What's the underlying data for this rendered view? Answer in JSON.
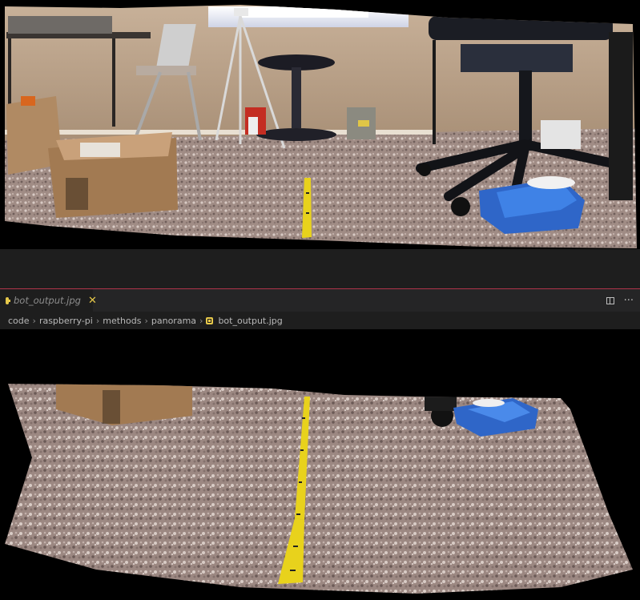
{
  "editor": {
    "tab": {
      "label": "bot_output.jpg",
      "icon": "image-file-icon",
      "close_glyph": "✕"
    },
    "actions": {
      "split_icon": "split-editor-icon",
      "more_glyph": "···"
    },
    "breadcrumb": [
      "code",
      "raspberry-pi",
      "methods",
      "panorama",
      "bot_output.jpg"
    ],
    "breadcrumb_separator": "›"
  },
  "images": {
    "top": {
      "description_icon": "panorama-photo-room"
    },
    "bottom": {
      "description_icon": "panorama-photo-floor"
    }
  },
  "colors": {
    "editor_bg": "#1e1e1e",
    "tab_bar_bg": "#252526",
    "accent_border": "#b0344a",
    "file_icon": "#e6c84a",
    "tape_yellow": "#e8d21c"
  }
}
